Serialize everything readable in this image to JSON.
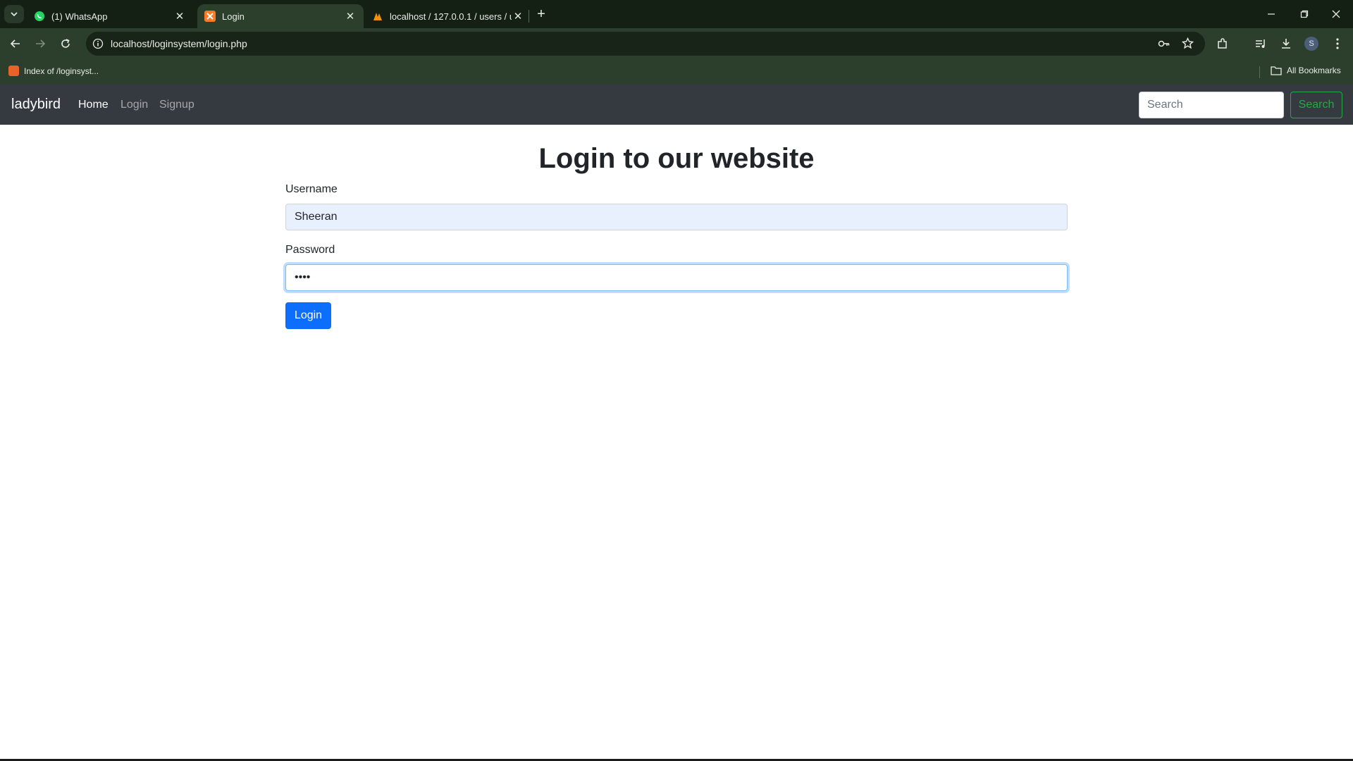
{
  "browser": {
    "tabs": [
      {
        "title": "(1) WhatsApp",
        "icon": "whatsapp-icon",
        "active": false
      },
      {
        "title": "Login",
        "icon": "xampp-icon",
        "active": true
      },
      {
        "title": "localhost / 127.0.0.1 / users / u",
        "icon": "phpmyadmin-icon",
        "active": false
      }
    ],
    "url": "localhost/loginsystem/login.php",
    "bookmarks": [
      {
        "label": "Index of /loginsyst..."
      }
    ],
    "all_bookmarks_label": "All Bookmarks",
    "profile_initial": "S",
    "colors": {
      "frame": "#152015",
      "toolbar": "#2c3f2c"
    }
  },
  "navbar": {
    "brand": "ladybird",
    "links": [
      {
        "label": "Home",
        "active": true
      },
      {
        "label": "Login",
        "active": false
      },
      {
        "label": "Signup",
        "active": false
      }
    ],
    "search_placeholder": "Search",
    "search_button": "Search"
  },
  "form": {
    "title": "Login to our website",
    "username_label": "Username",
    "username_value": "Sheeran",
    "password_label": "Password",
    "password_value": "••••",
    "submit_label": "Login"
  },
  "colors": {
    "navbar": "#343a40",
    "primary": "#0d6efd",
    "success": "#28a745"
  }
}
